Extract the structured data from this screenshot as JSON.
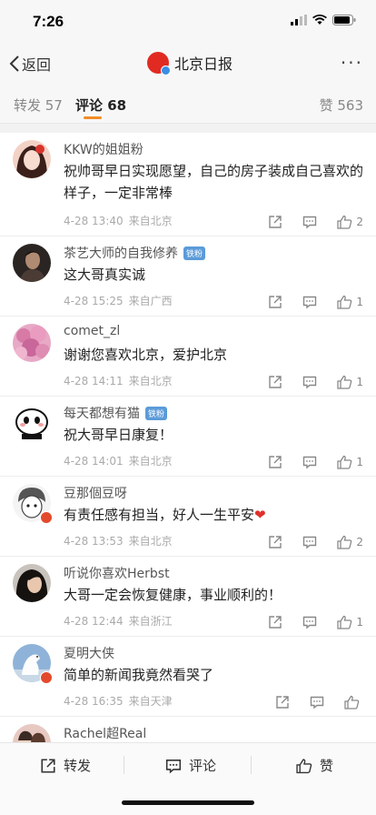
{
  "status": {
    "time": "7:26"
  },
  "nav": {
    "back_label": "返回",
    "title": "北京日报",
    "more_label": "···"
  },
  "tabs": {
    "repost": "转发 57",
    "comment": "评论 68",
    "like": "赞 563"
  },
  "colors": {
    "accent": "#f28c28",
    "like_red": "#e0302a",
    "badge_blue": "#5b9bd9",
    "brand_red": "#e12a22"
  },
  "comments": [
    {
      "author": "KKW的姐姐粉",
      "badge": "",
      "text": "祝帅哥早日实现愿望，自己的房子装成自己喜欢的样子，一定非常棒",
      "date": "4-28 13:40",
      "location": "来自北京",
      "likes": "2",
      "avatar_icon": "avatar-anime-girl"
    },
    {
      "author": "茶艺大师的自我修养",
      "badge": "铁粉",
      "text": "这大哥真实诚",
      "date": "4-28 15:25",
      "location": "来自广西",
      "likes": "1",
      "avatar_icon": "avatar-dark-portrait"
    },
    {
      "author": "comet_zl",
      "badge": "",
      "text": "谢谢您喜欢北京，爱护北京",
      "date": "4-28 14:11",
      "location": "来自北京",
      "likes": "1",
      "avatar_icon": "avatar-pink-flowers"
    },
    {
      "author": "每天都想有猫",
      "badge": "铁粉",
      "text": "祝大哥早日康复！",
      "date": "4-28 14:01",
      "location": "来自北京",
      "likes": "1",
      "avatar_icon": "avatar-cartoon-face"
    },
    {
      "author": "豆那個豆呀",
      "badge": "",
      "text": "有责任感有担当，好人一生平安",
      "emoji": "❤",
      "date": "4-28 13:53",
      "location": "来自北京",
      "likes": "2",
      "avatar_icon": "avatar-manga-sketch"
    },
    {
      "author": "听说你喜欢Herbst",
      "badge": "",
      "text": "大哥一定会恢复健康，事业顺利的！",
      "date": "4-28 12:44",
      "location": "来自浙江",
      "likes": "1",
      "avatar_icon": "avatar-dark-hair"
    },
    {
      "author": "夏明大侠",
      "badge": "",
      "text": "简单的新闻我竟然看哭了",
      "date": "4-28 16:35",
      "location": "来自天津",
      "likes": "",
      "avatar_icon": "avatar-white-horse"
    },
    {
      "author": "Rachel超Real",
      "badge": "",
      "text": "",
      "date": "",
      "location": "",
      "likes": "",
      "avatar_icon": "avatar-couple-photo"
    }
  ],
  "bottom_bar": {
    "repost": "转发",
    "comment": "评论",
    "like": "赞"
  }
}
